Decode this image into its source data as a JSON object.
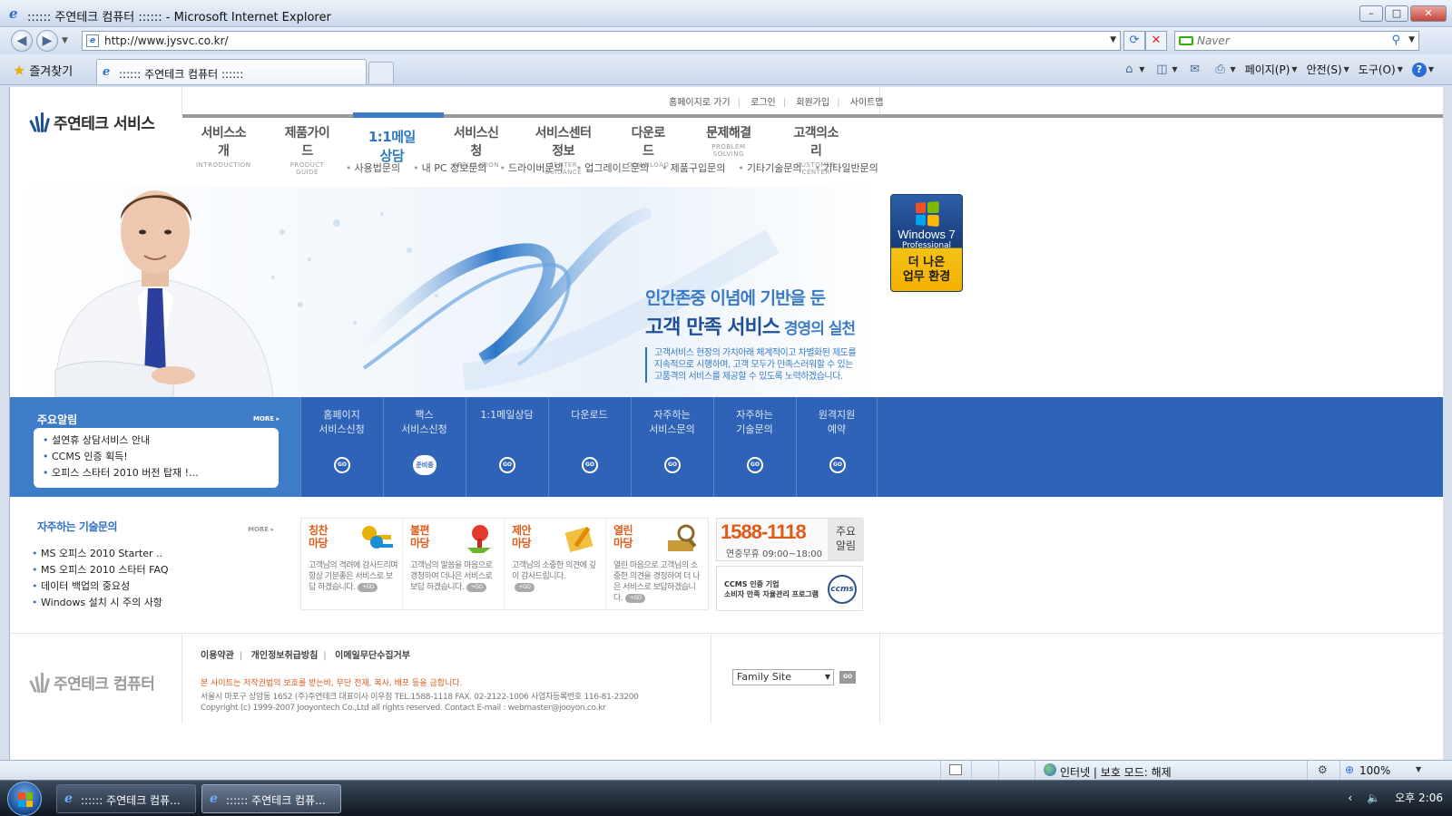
{
  "window": {
    "title": ":::::: 주연테크 컴퓨터 :::::: - Microsoft Internet Explorer",
    "buttons": {
      "minimize": "–",
      "maximize": "□",
      "close": "✕"
    }
  },
  "address": {
    "url": "http://www.jysvc.co.kr/",
    "search_placeholder": "Naver"
  },
  "tabs": {
    "favorites_label": "즐겨찾기",
    "active_tab": ":::::: 주연테크 컴퓨터 ::::::"
  },
  "command_bar": {
    "page": "페이지(P)",
    "safety": "안전(S)",
    "tools": "도구(O)",
    "help": "?"
  },
  "site": {
    "logo_text": "주연테크 서비스",
    "util_menu": [
      "홈페이지로 가기",
      "로그인",
      "회원가입",
      "사이트맵"
    ],
    "gnb": [
      {
        "ko": "서비스소개",
        "en": "INTRODUCTION"
      },
      {
        "ko": "제품가이드",
        "en": "PRODUCT GUIDE"
      },
      {
        "ko": "1:1메일상담",
        "en": ""
      },
      {
        "ko": "서비스신청",
        "en": "APPLICATION"
      },
      {
        "ko": "서비스센터정보",
        "en": "CENTER GUIDANCE"
      },
      {
        "ko": "다운로드",
        "en": "DOWNLOAD"
      },
      {
        "ko": "문제해결",
        "en": "PROBLEM SOLVING"
      },
      {
        "ko": "고객의소리",
        "en": "CUSTOMER CENTER"
      }
    ],
    "sub_menu": [
      "사용법문의",
      "내 PC 정보문의",
      "드라이버문의",
      "업그레이드문의",
      "제품구입문의",
      "기타기술문의",
      "기타일반문의"
    ],
    "hero": {
      "line1": "인간존중 이념에 기반을 둔",
      "line2_main": "고객 만족 서비스",
      "line2_sub": " 경영의 실천",
      "body": "고객서비스 현장의 가치아래 체계적이고 차별화된 제도를 지속적으로 시행하며, 고객 모두가 만족스러워할 수 있는 고품격의 서비스를 제공할 수 있도록 노력하겠습니다."
    },
    "win7": {
      "brand": "Windows 7",
      "edition": "Professional",
      "line1": "더 나은",
      "line2": "업무 환경"
    },
    "notice": {
      "title": "주요알림",
      "more": "MORE ▸",
      "items": [
        "설연휴 상담서비스 안내",
        "CCMS 인증 획득!",
        "오피스 스타터 2010 버전 탑재 !..."
      ]
    },
    "quick_links": [
      {
        "label": "홈페이지\n서비스신청",
        "button": "GO"
      },
      {
        "label": "팩스\n서비스신청",
        "button": "준비중"
      },
      {
        "label": "1:1메일상담",
        "button": "GO"
      },
      {
        "label": "다운로드",
        "button": "GO"
      },
      {
        "label": "자주하는\n서비스문의",
        "button": "GO"
      },
      {
        "label": "자주하는\n기술문의",
        "button": "GO"
      },
      {
        "label": "원격지원\n예약",
        "button": "GO"
      }
    ],
    "faq": {
      "title": "자주하는 기술문의",
      "more": "MORE ▸",
      "items": [
        "MS 오피스 2010 Starter ..",
        "MS 오피스 2010 스타터 FAQ",
        "데이터 백업의 중요성",
        "Windows 설치 시 주의 사항"
      ]
    },
    "madang": [
      {
        "title1": "칭찬",
        "title2": "마당",
        "body": "고객님의 격려에 감사드리며 항상 기분좋은 서비스로 보답 하겠습니다.",
        "go": "+GO",
        "color1": "#e8b000",
        "color2": "#1a8fd8"
      },
      {
        "title1": "불편",
        "title2": "마당",
        "body": "고객님의 말씀을 마음으로 경청하여 더나은 서비스로 보답 하겠습니다.",
        "go": "+GO",
        "color1": "#e23b2b",
        "color2": "#6bb52a"
      },
      {
        "title1": "제안",
        "title2": "마당",
        "body": "고객님의 소중한 의견에 깊이 감사드립니다.",
        "go": "+GO",
        "color1": "#f0c040",
        "color2": "#e08a00"
      },
      {
        "title1": "열린",
        "title2": "마당",
        "body": "열린 마음으로 고객님의 소중한 의견을 경청하여 더 나은 서비스로 보답하겠습니다.",
        "go": "+GO",
        "color1": "#c99a3a",
        "color2": "#8a6a2a"
      }
    ],
    "phone": {
      "number": "1588-1118",
      "hours": "연중무휴 09:00~18:00",
      "side": "주요\n알림"
    },
    "ccms": {
      "line1": "CCMS 인증 기업",
      "line2": "소비자 만족 자율관리 프로그램",
      "seal": "ccms"
    },
    "footer": {
      "logo_text": "주연테크 컴퓨터",
      "links": [
        "이용약관",
        "개인정보취급방침",
        "이메일무단수집거부"
      ],
      "warning": "본 사이트는 저작권법의 보호를 받는바, 무단 전재, 복사, 배포 등을 금합니다.",
      "address": "서울시 마포구 상암동 1652 (주)주연테크 대표이사 이우정   TEL.1588-1118    FAX. 02-2122-1006    사업자등록번호 116-81-23200",
      "copyright": "Copyright (c) 1999-2007 Jooyontech Co.,Ltd all rights reserved.     Contact E-mail : webmaster@jooyon.co.kr",
      "family_site": "Family Site",
      "family_go": "GO"
    }
  },
  "statusbar": {
    "zone": "인터넷 | 보호 모드: 해제",
    "zoom": "100%"
  },
  "taskbar": {
    "tasks": [
      ":::::: 주연테크 컴퓨...",
      ":::::: 주연테크 컴퓨..."
    ],
    "clock": "오후 2:06"
  },
  "colors": {
    "brand_blue": "#2f63b7",
    "accent_orange": "#e05a1a"
  }
}
